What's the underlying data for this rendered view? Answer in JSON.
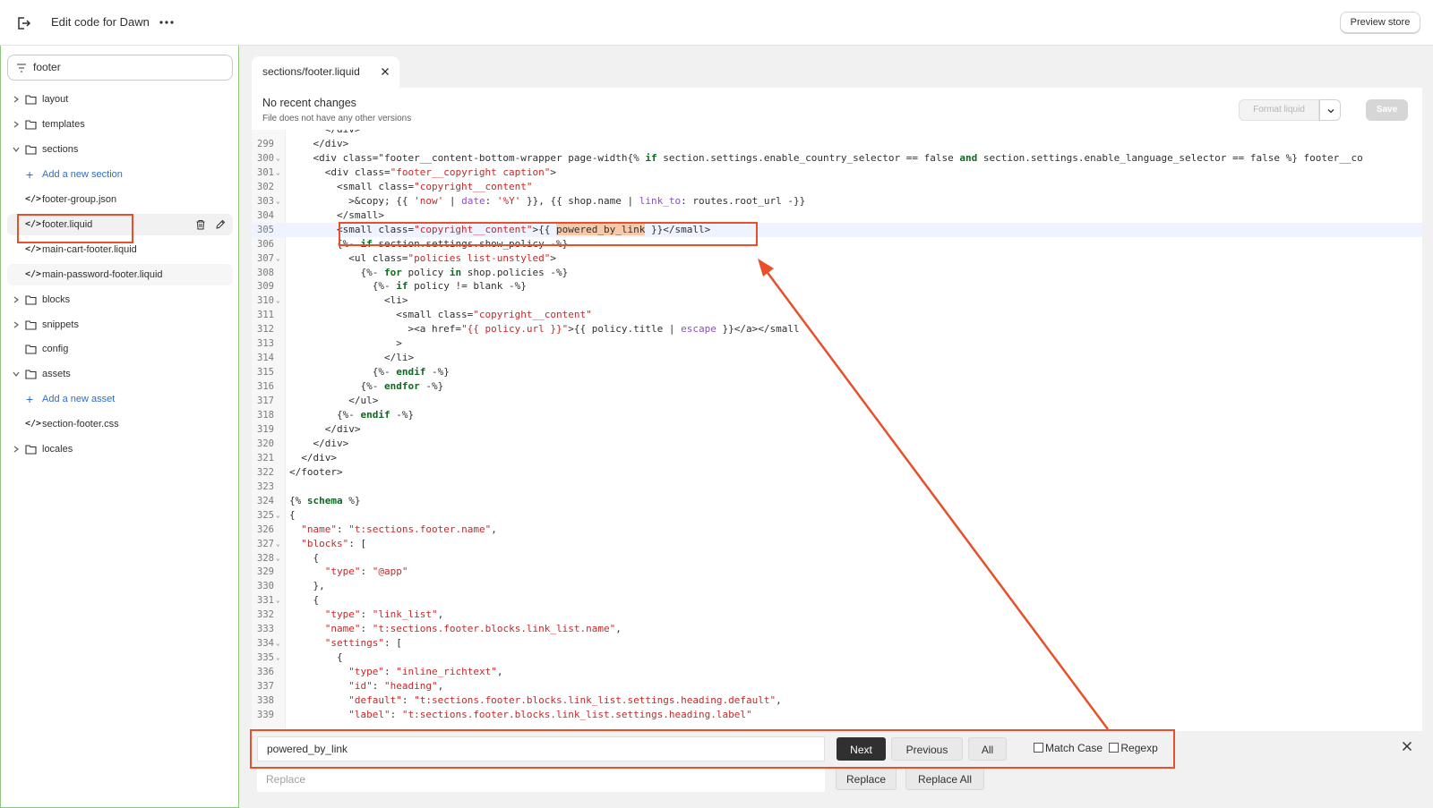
{
  "topbar": {
    "title": "Edit code for Dawn",
    "preview_label": "Preview store"
  },
  "sidebar": {
    "search_value": "footer",
    "items": [
      {
        "type": "folder",
        "label": "layout",
        "expanded": false
      },
      {
        "type": "folder",
        "label": "templates",
        "expanded": false
      },
      {
        "type": "folder",
        "label": "sections",
        "expanded": true
      },
      {
        "type": "add",
        "label": "Add a new section"
      },
      {
        "type": "file",
        "label": "footer-group.json"
      },
      {
        "type": "file",
        "label": "footer.liquid",
        "selected": true
      },
      {
        "type": "file",
        "label": "main-cart-footer.liquid"
      },
      {
        "type": "file",
        "label": "main-password-footer.liquid"
      },
      {
        "type": "folder",
        "label": "blocks",
        "expanded": false
      },
      {
        "type": "folder",
        "label": "snippets",
        "expanded": false
      },
      {
        "type": "folder",
        "label": "config",
        "expanded": false
      },
      {
        "type": "folder",
        "label": "assets",
        "expanded": true
      },
      {
        "type": "add",
        "label": "Add a new asset"
      },
      {
        "type": "file",
        "label": "section-footer.css"
      },
      {
        "type": "folder",
        "label": "locales",
        "expanded": false
      }
    ]
  },
  "editor": {
    "tab_prefix": "sections/",
    "tab_name": "footer.liquid",
    "status_title": "No recent changes",
    "status_sub": "File does not have any other versions",
    "format_label": "Format liquid",
    "save_label": "Save"
  },
  "code_lines": [
    {
      "n": "",
      "fold": "",
      "t": "      </div>"
    },
    {
      "n": "299",
      "fold": "",
      "t": "    </div>"
    },
    {
      "n": "300",
      "fold": "⌄",
      "t": "    <div class=\"footer__content-bottom-wrapper page-width{% if section.settings.enable_country_selector == false and section.settings.enable_language_selector == false %} footer__co"
    },
    {
      "n": "301",
      "fold": "⌄",
      "t": "      <div class=\"footer__copyright caption\">"
    },
    {
      "n": "302",
      "fold": "",
      "t": "        <small class=\"copyright__content\""
    },
    {
      "n": "303",
      "fold": "⌄",
      "t": "          >&copy; {{ 'now' | date: '%Y' }}, {{ shop.name | link_to: routes.root_url -}}"
    },
    {
      "n": "304",
      "fold": "",
      "t": "        </small>"
    },
    {
      "n": "305",
      "fold": "",
      "t": "        <small class=\"copyright__content\">{{ powered_by_link }}</small>"
    },
    {
      "n": "306",
      "fold": "",
      "t": "        {%- if section.settings.show_policy -%}"
    },
    {
      "n": "307",
      "fold": "⌄",
      "t": "          <ul class=\"policies list-unstyled\">"
    },
    {
      "n": "308",
      "fold": "",
      "t": "            {%- for policy in shop.policies -%}"
    },
    {
      "n": "309",
      "fold": "",
      "t": "              {%- if policy != blank -%}"
    },
    {
      "n": "310",
      "fold": "⌄",
      "t": "                <li>"
    },
    {
      "n": "311",
      "fold": "",
      "t": "                  <small class=\"copyright__content\""
    },
    {
      "n": "312",
      "fold": "",
      "t": "                    ><a href=\"{{ policy.url }}\">{{ policy.title | escape }}</a></small"
    },
    {
      "n": "313",
      "fold": "",
      "t": "                  >"
    },
    {
      "n": "314",
      "fold": "",
      "t": "                </li>"
    },
    {
      "n": "315",
      "fold": "",
      "t": "              {%- endif -%}"
    },
    {
      "n": "316",
      "fold": "",
      "t": "            {%- endfor -%}"
    },
    {
      "n": "317",
      "fold": "",
      "t": "          </ul>"
    },
    {
      "n": "318",
      "fold": "",
      "t": "        {%- endif -%}"
    },
    {
      "n": "319",
      "fold": "",
      "t": "      </div>"
    },
    {
      "n": "320",
      "fold": "",
      "t": "    </div>"
    },
    {
      "n": "321",
      "fold": "",
      "t": "  </div>"
    },
    {
      "n": "322",
      "fold": "",
      "t": "</footer>"
    },
    {
      "n": "323",
      "fold": "",
      "t": ""
    },
    {
      "n": "324",
      "fold": "",
      "t": "{% schema %}"
    },
    {
      "n": "325",
      "fold": "⌄",
      "t": "{"
    },
    {
      "n": "326",
      "fold": "",
      "t": "  \"name\": \"t:sections.footer.name\","
    },
    {
      "n": "327",
      "fold": "⌄",
      "t": "  \"blocks\": ["
    },
    {
      "n": "328",
      "fold": "⌄",
      "t": "    {"
    },
    {
      "n": "329",
      "fold": "",
      "t": "      \"type\": \"@app\""
    },
    {
      "n": "330",
      "fold": "",
      "t": "    },"
    },
    {
      "n": "331",
      "fold": "⌄",
      "t": "    {"
    },
    {
      "n": "332",
      "fold": "",
      "t": "      \"type\": \"link_list\","
    },
    {
      "n": "333",
      "fold": "",
      "t": "      \"name\": \"t:sections.footer.blocks.link_list.name\","
    },
    {
      "n": "334",
      "fold": "⌄",
      "t": "      \"settings\": ["
    },
    {
      "n": "335",
      "fold": "⌄",
      "t": "        {"
    },
    {
      "n": "336",
      "fold": "",
      "t": "          \"type\": \"inline_richtext\","
    },
    {
      "n": "337",
      "fold": "",
      "t": "          \"id\": \"heading\","
    },
    {
      "n": "338",
      "fold": "",
      "t": "          \"default\": \"t:sections.footer.blocks.link_list.settings.heading.default\","
    },
    {
      "n": "339",
      "fold": "",
      "t": "          \"label\": \"t:sections.footer.blocks.link_list.settings.heading.label\""
    }
  ],
  "find": {
    "search_value": "powered_by_link",
    "replace_placeholder": "Replace",
    "next_label": "Next",
    "previous_label": "Previous",
    "all_label": "All",
    "match_case_label": "Match Case",
    "regexp_label": "Regexp",
    "replace_label": "Replace",
    "replace_all_label": "Replace All"
  },
  "colors": {
    "annotation": "#e8502a",
    "accent_link": "#2c6ecb"
  }
}
